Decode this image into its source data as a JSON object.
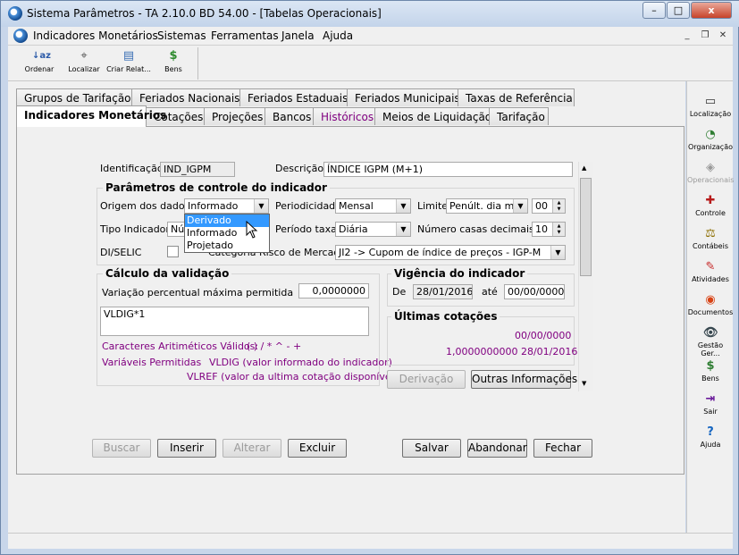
{
  "window": {
    "title": "Sistema Parâmetros -  TA 2.10.0 BD 54.00 - [Tabelas Operacionais]",
    "minimize": "–",
    "maximize": "□",
    "close": "x"
  },
  "menu": {
    "items": [
      "Indicadores Monetários",
      "Sistemas",
      "Ferramentas",
      "Janela",
      "Ajuda"
    ]
  },
  "toolbar": {
    "items": [
      {
        "label": "Ordenar",
        "icon": "sort-az-icon"
      },
      {
        "label": "Localizar",
        "icon": "locate-icon"
      },
      {
        "label": "Criar Relat...",
        "icon": "report-icon"
      },
      {
        "label": "Bens",
        "icon": "money-bag-icon"
      }
    ]
  },
  "right_toolbar": {
    "items": [
      {
        "label": "Localização",
        "glyph": "▭"
      },
      {
        "label": "Organização",
        "glyph": "◔"
      },
      {
        "label": "Operacionais",
        "glyph": "◈"
      },
      {
        "label": "Controle",
        "glyph": "✚"
      },
      {
        "label": "Contábeis",
        "glyph": "⚖"
      },
      {
        "label": "Atividades",
        "glyph": "✎"
      },
      {
        "label": "Documentos",
        "glyph": "◉"
      },
      {
        "label": "Gestão Ger...",
        "glyph": "👁"
      },
      {
        "label": "Bens",
        "glyph": "$"
      },
      {
        "label": "Sair",
        "glyph": "⇥"
      },
      {
        "label": "Ajuda",
        "glyph": "?"
      }
    ]
  },
  "tabs_row1": [
    "Grupos de Tarifação",
    "Feriados Nacionais",
    "Feriados Estaduais",
    "Feriados Municipais",
    "Taxas de Referência"
  ],
  "tabs_row2": [
    "Indicadores Monetários",
    "Cotações",
    "Projeções",
    "Bancos",
    "Históricos",
    "Meios de Liquidação",
    "Tarifação"
  ],
  "form": {
    "identificacao_label": "Identificação",
    "identificacao_value": "IND_IGPM",
    "descricao_label": "Descrição",
    "descricao_value": "ÍNDICE IGPM (M+1)",
    "params_title": "Parâmetros de controle do indicador",
    "origem_label": "Origem dos dados",
    "origem_value": "Informado",
    "origem_options": [
      "Derivado",
      "Informado",
      "Projetado"
    ],
    "periodicidade_label": "Periodicidade",
    "periodicidade_value": "Mensal",
    "limite_label": "Limite",
    "limite_value": "Penúlt. dia mês",
    "limite_num": "00",
    "tipo_label": "Tipo Indicador",
    "tipo_value": "Nú",
    "periodo_label": "Período taxa",
    "periodo_value": "Diária",
    "casas_label": "Número casas decimais",
    "casas_value": "10",
    "diselic_label": "DI/SELIC",
    "categoria_label": "Categoria Risco de Mercado",
    "categoria_value": "JI2 -> Cupom de índice de preços - IGP-M"
  },
  "validacao": {
    "title": "Cálculo da validação",
    "variacao_label": "Variação percentual máxima permitida",
    "variacao_value": "0,0000000",
    "formula": "VLDIG*1",
    "caracteres_label": "Caracteres Aritiméticos Válidos:",
    "caracteres_value": "( ) / * ^ - +",
    "variaveis_label": "Variáveis Permitidas",
    "vldig": "VLDIG  (valor informado do indicador)",
    "vlref": "VLREF (valor da ultima cotação disponível)"
  },
  "vigencia": {
    "title": "Vigência do indicador",
    "de_label": "De",
    "de_value": "28/01/2016",
    "ate_label": "até",
    "ate_value": "00/00/0000"
  },
  "cotacoes": {
    "title": "Últimas cotações",
    "line1": "00/00/0000",
    "line2": "1,0000000000  28/01/2016"
  },
  "side_buttons": {
    "derivacao": "Derivação",
    "outras": "Outras Informações"
  },
  "actions": {
    "buscar": "Buscar",
    "inserir": "Inserir",
    "alterar": "Alterar",
    "excluir": "Excluir",
    "salvar": "Salvar",
    "abandonar": "Abandonar",
    "fechar": "Fechar"
  },
  "colors": {
    "purple_text": "#800080",
    "highlight": "#3399ff"
  }
}
